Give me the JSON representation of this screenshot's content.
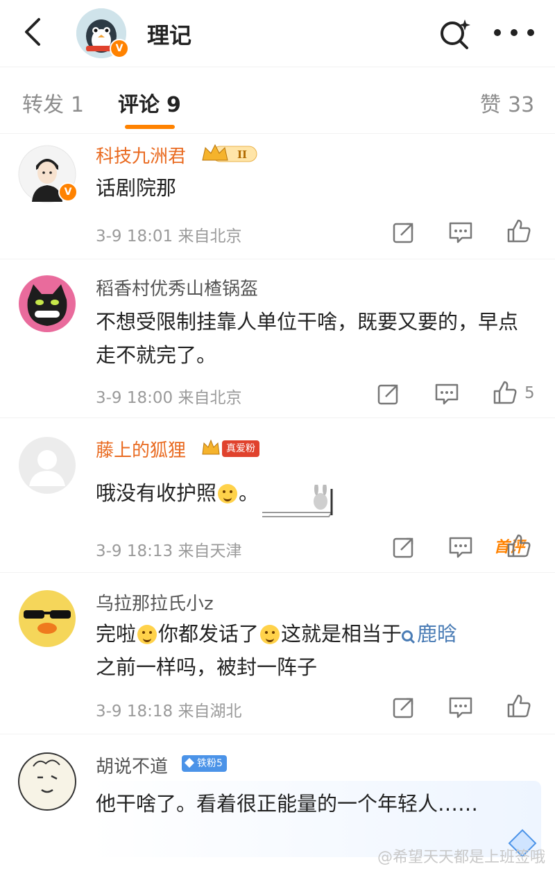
{
  "header": {
    "title": "理记",
    "verified_mark": "V",
    "back_icon": "chevron-left-icon",
    "search_icon": "search-icon",
    "more_icon": "more-dots-icon"
  },
  "tabs": [
    {
      "label": "转发",
      "count": "1"
    },
    {
      "label": "评论",
      "count": "9"
    },
    {
      "label": "赞",
      "count": "33"
    }
  ],
  "accent_color": "#ff8200",
  "comments": [
    {
      "name": "科技九洲君",
      "badge": "II",
      "text": "话剧院那",
      "time": "3-9 18:01",
      "location": "来自北京",
      "likes": ""
    },
    {
      "name": "稻香村优秀山楂锅盔",
      "tag": "首评",
      "text": "不想受限制挂靠人单位干啥，既要又要的，早点走不就完了。",
      "time": "3-9 18:00",
      "location": "来自北京",
      "likes": "5"
    },
    {
      "name": "藤上的狐狸",
      "badge": "真爱粉",
      "text_before": "哦没有收护照",
      "text_after": "。",
      "time": "3-9 18:13",
      "location": "来自天津",
      "likes": ""
    },
    {
      "name": "乌拉那拉氏小z",
      "text_a": "完啦",
      "text_b": "你都发话了",
      "text_c": "这就是相当于",
      "topic": "鹿晗",
      "text_d": "之前一样吗，被封一阵子",
      "time": "3-9 18:18",
      "location": "来自湖北",
      "likes": ""
    },
    {
      "name": "胡说不道",
      "badge": "铁粉5",
      "text": "他干啥了。看着很正能量的一个年轻人……"
    }
  ],
  "watermark": "@希望天天都是上班签哦"
}
